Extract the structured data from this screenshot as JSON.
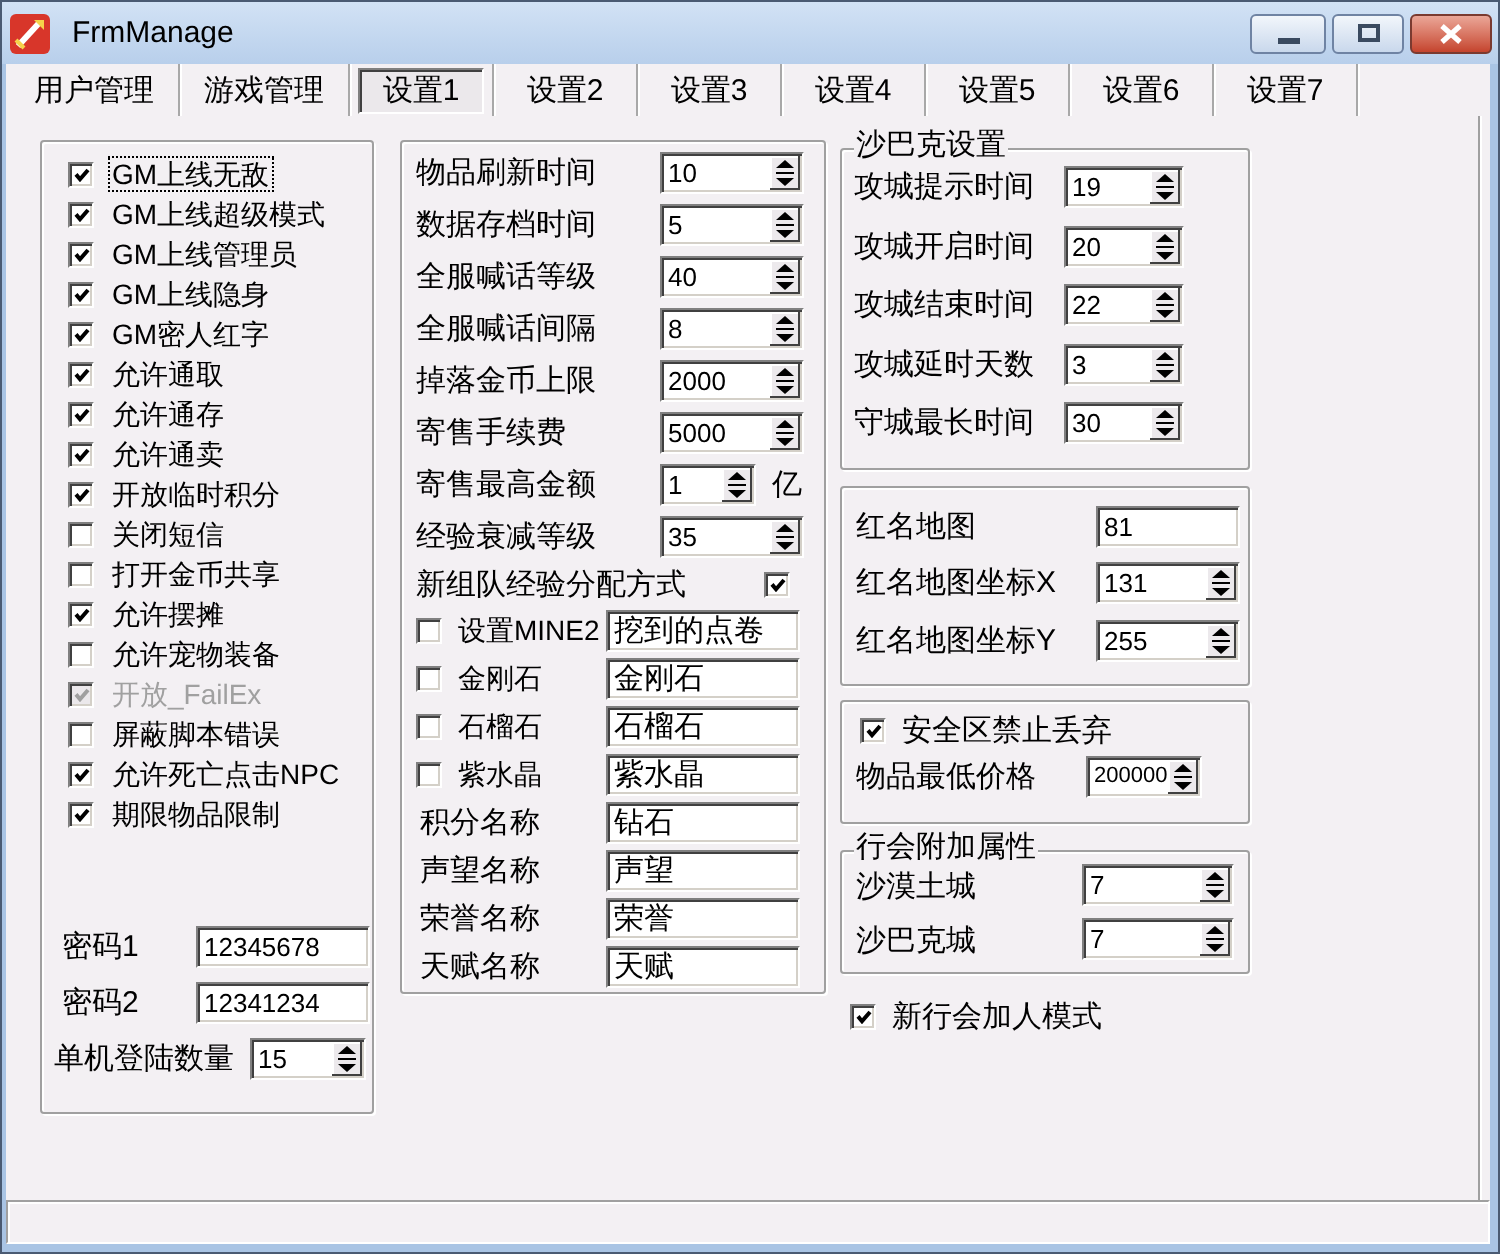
{
  "window": {
    "title": "FrmManage"
  },
  "tabs": [
    {
      "label": "用户管理",
      "selected": false
    },
    {
      "label": "游戏管理",
      "selected": false
    },
    {
      "label": "设置1",
      "selected": true
    },
    {
      "label": "设置2",
      "selected": false
    },
    {
      "label": "设置3",
      "selected": false
    },
    {
      "label": "设置4",
      "selected": false
    },
    {
      "label": "设置5",
      "selected": false
    },
    {
      "label": "设置6",
      "selected": false
    },
    {
      "label": "设置7",
      "selected": false
    }
  ],
  "left_group": {
    "checkboxes": [
      {
        "label": "GM上线无敌",
        "checked": true,
        "disabled": false,
        "focused": true
      },
      {
        "label": "GM上线超级模式",
        "checked": true,
        "disabled": false,
        "focused": false
      },
      {
        "label": "GM上线管理员",
        "checked": true,
        "disabled": false,
        "focused": false
      },
      {
        "label": "GM上线隐身",
        "checked": true,
        "disabled": false,
        "focused": false
      },
      {
        "label": "GM密人红字",
        "checked": true,
        "disabled": false,
        "focused": false
      },
      {
        "label": "允许通取",
        "checked": true,
        "disabled": false,
        "focused": false
      },
      {
        "label": "允许通存",
        "checked": true,
        "disabled": false,
        "focused": false
      },
      {
        "label": "允许通卖",
        "checked": true,
        "disabled": false,
        "focused": false
      },
      {
        "label": "开放临时积分",
        "checked": true,
        "disabled": false,
        "focused": false
      },
      {
        "label": "关闭短信",
        "checked": false,
        "disabled": false,
        "focused": false
      },
      {
        "label": "打开金币共享",
        "checked": false,
        "disabled": false,
        "focused": false
      },
      {
        "label": "允许摆摊",
        "checked": true,
        "disabled": false,
        "focused": false
      },
      {
        "label": "允许宠物装备",
        "checked": false,
        "disabled": false,
        "focused": false
      },
      {
        "label": "开放_FailEx",
        "checked": true,
        "disabled": true,
        "focused": false
      },
      {
        "label": "屏蔽脚本错误",
        "checked": false,
        "disabled": false,
        "focused": false
      },
      {
        "label": "允许死亡点击NPC",
        "checked": true,
        "disabled": false,
        "focused": false
      },
      {
        "label": "期限物品限制",
        "checked": true,
        "disabled": false,
        "focused": false
      }
    ],
    "fields": [
      {
        "kind": "edit",
        "label": "密码1",
        "value": "12345678"
      },
      {
        "kind": "edit",
        "label": "密码2",
        "value": "12341234"
      },
      {
        "kind": "spin",
        "label": "单机登陆数量",
        "value": "15"
      }
    ]
  },
  "middle_group": {
    "settings": [
      {
        "label": "物品刷新时间",
        "value": "10"
      },
      {
        "label": "数据存档时间",
        "value": "5"
      },
      {
        "label": "全服喊话等级",
        "value": "40"
      },
      {
        "label": "全服喊话间隔",
        "value": "8"
      },
      {
        "label": "掉落金币上限",
        "value": "2000"
      },
      {
        "label": "寄售手续费",
        "value": "5000"
      },
      {
        "label": "寄售最高金额",
        "value": "1",
        "unit": "亿"
      },
      {
        "label": "经验衰减等级",
        "value": "35"
      }
    ],
    "party_exp": {
      "label": "新组队经验分配方式",
      "checked": true
    },
    "mine_items": [
      {
        "label": "设置MINE2",
        "checked": false,
        "value": "挖到的点卷"
      },
      {
        "label": "金刚石",
        "checked": false,
        "value": "金刚石"
      },
      {
        "label": "石榴石",
        "checked": false,
        "value": "石榴石"
      },
      {
        "label": "紫水晶",
        "checked": false,
        "value": "紫水晶"
      }
    ],
    "point_names": [
      {
        "label": "积分名称",
        "value": "钻石"
      },
      {
        "label": "声望名称",
        "value": "声望"
      },
      {
        "label": "荣誉名称",
        "value": "荣誉"
      },
      {
        "label": "天赋名称",
        "value": "天赋"
      }
    ]
  },
  "sabac_group": {
    "title": "沙巴克设置",
    "settings": [
      {
        "label": "攻城提示时间",
        "value": "19"
      },
      {
        "label": "攻城开启时间",
        "value": "20"
      },
      {
        "label": "攻城结束时间",
        "value": "22"
      },
      {
        "label": "攻城延时天数",
        "value": "3"
      },
      {
        "label": "守城最长时间",
        "value": "30"
      }
    ]
  },
  "red_name_group": {
    "fields": [
      {
        "kind": "edit",
        "label": "红名地图",
        "value": "81"
      },
      {
        "kind": "spin",
        "label": "红名地图坐标X",
        "value": "131"
      },
      {
        "kind": "spin",
        "label": "红名地图坐标Y",
        "value": "255"
      }
    ]
  },
  "safe_zone_group": {
    "no_drop": {
      "label": "安全区禁止丢弃",
      "checked": true
    },
    "min_price": {
      "label": "物品最低价格",
      "value": "200000"
    }
  },
  "guild_group": {
    "title": "行会附加属性",
    "settings": [
      {
        "label": "沙漠土城",
        "value": "7"
      },
      {
        "label": "沙巴克城",
        "value": "7"
      }
    ]
  },
  "new_guild_mode": {
    "label": "新行会加人模式",
    "checked": true
  }
}
